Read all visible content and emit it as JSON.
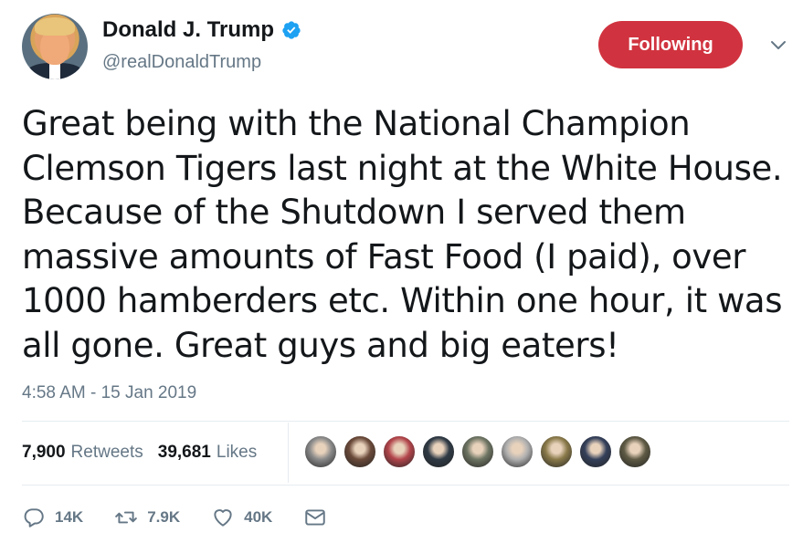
{
  "author": {
    "name": "Donald J. Trump",
    "handle": "@realDonaldTrump",
    "verified": true
  },
  "follow_button": {
    "label": "Following",
    "color": "#d0333f"
  },
  "tweet": {
    "text": "Great being with the National Champion Clemson Tigers last night at the White House. Because of the Shutdown I served them massive amounts of Fast Food (I paid), over 1000 hamberders etc. Within one hour, it was all gone. Great guys and big eaters!",
    "timestamp": "4:58 AM - 15 Jan 2019"
  },
  "stats": {
    "retweets_count": "7,900",
    "retweets_label": "Retweets",
    "likes_count": "39,681",
    "likes_label": "Likes"
  },
  "likers": [
    {
      "name": "liker-avatar-1",
      "color": "#8a8a8a"
    },
    {
      "name": "liker-avatar-2",
      "color": "#6b4a3a"
    },
    {
      "name": "liker-avatar-3",
      "color": "#b2454b"
    },
    {
      "name": "liker-avatar-4",
      "color": "#2f3a45"
    },
    {
      "name": "liker-avatar-5",
      "color": "#6e7563"
    },
    {
      "name": "liker-avatar-6",
      "color": "#b0b0b0"
    },
    {
      "name": "liker-avatar-7",
      "color": "#8a7a4a"
    },
    {
      "name": "liker-avatar-8",
      "color": "#34405a"
    },
    {
      "name": "liker-avatar-9",
      "color": "#5e5a44"
    }
  ],
  "actions": {
    "reply_count": "14K",
    "retweet_count": "7.9K",
    "like_count": "40K"
  },
  "colors": {
    "accent": "#1da1f2",
    "secondary_text": "#657786",
    "primary_text": "#14171a"
  }
}
